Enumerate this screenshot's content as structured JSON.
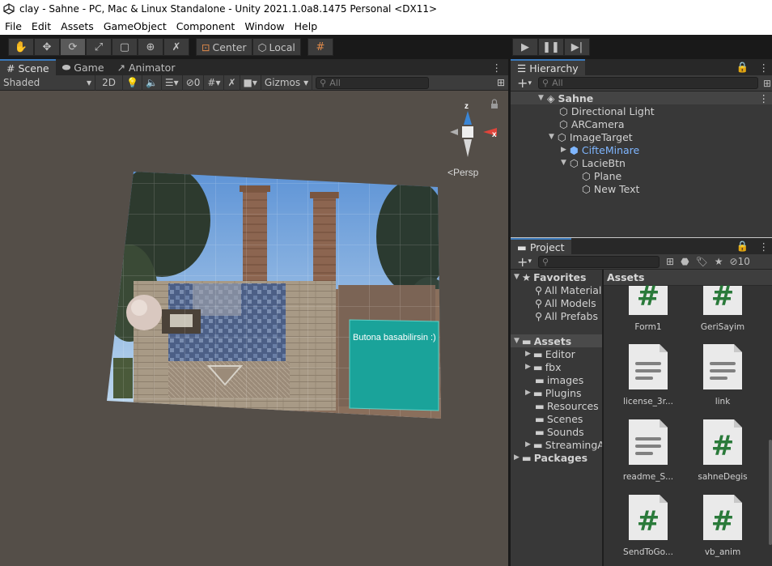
{
  "window": {
    "title": "clay - Sahne - PC, Mac & Linux Standalone - Unity 2021.1.0a8.1475 Personal <DX11>"
  },
  "menu": [
    "File",
    "Edit",
    "Assets",
    "GameObject",
    "Component",
    "Window",
    "Help"
  ],
  "toolbar": {
    "pivot_label": "Center",
    "space_label": "Local"
  },
  "scene": {
    "tabs": [
      "Scene",
      "Game",
      "Animator"
    ],
    "shading": "Shaded",
    "mode_2d": "2D",
    "hidden_count": "0",
    "gizmos_label": "Gizmos",
    "search_placeholder": "All",
    "persp_label": "<Persp",
    "axis_x": "x",
    "axis_z": "z",
    "button_text": "Butona basabilirsin :)"
  },
  "hierarchy": {
    "tab": "Hierarchy",
    "search_placeholder": "All",
    "items": [
      {
        "label": "Sahne",
        "depth": 0,
        "expanded": true,
        "bold": true
      },
      {
        "label": "Directional Light",
        "depth": 1
      },
      {
        "label": "ARCamera",
        "depth": 1
      },
      {
        "label": "ImageTarget",
        "depth": 1,
        "expanded": true
      },
      {
        "label": "CifteMinare",
        "depth": 2,
        "prefab": true,
        "collapsed": true
      },
      {
        "label": "LacieBtn",
        "depth": 2,
        "expanded": true
      },
      {
        "label": "Plane",
        "depth": 3
      },
      {
        "label": "New Text",
        "depth": 3
      }
    ]
  },
  "project": {
    "tab": "Project",
    "hidden_count": "10",
    "favorites_label": "Favorites",
    "favorites": [
      "All Materials",
      "All Models",
      "All Prefabs"
    ],
    "assets_label": "Assets",
    "folders": [
      {
        "label": "Editor",
        "has_children": true
      },
      {
        "label": "fbx",
        "has_children": true
      },
      {
        "label": "images",
        "has_children": false
      },
      {
        "label": "Plugins",
        "has_children": true
      },
      {
        "label": "Resources",
        "has_children": false
      },
      {
        "label": "Scenes",
        "has_children": false
      },
      {
        "label": "Sounds",
        "has_children": false
      },
      {
        "label": "StreamingA",
        "has_children": true
      }
    ],
    "packages_label": "Packages",
    "assets_header": "Assets",
    "files": [
      {
        "name": "Form1",
        "type": "script"
      },
      {
        "name": "GeriSayim",
        "type": "script"
      },
      {
        "name": "license_3r...",
        "type": "text"
      },
      {
        "name": "link",
        "type": "text"
      },
      {
        "name": "readme_S...",
        "type": "text"
      },
      {
        "name": "sahneDegis",
        "type": "script"
      },
      {
        "name": "SendToGo...",
        "type": "script"
      },
      {
        "name": "vb_anim",
        "type": "script"
      }
    ]
  },
  "colors": {
    "accent": "#3a79bb",
    "script_hash": "#2a7a3a",
    "teal_button": "#1aa39a",
    "prefab_blue": "#7fb6ff"
  }
}
